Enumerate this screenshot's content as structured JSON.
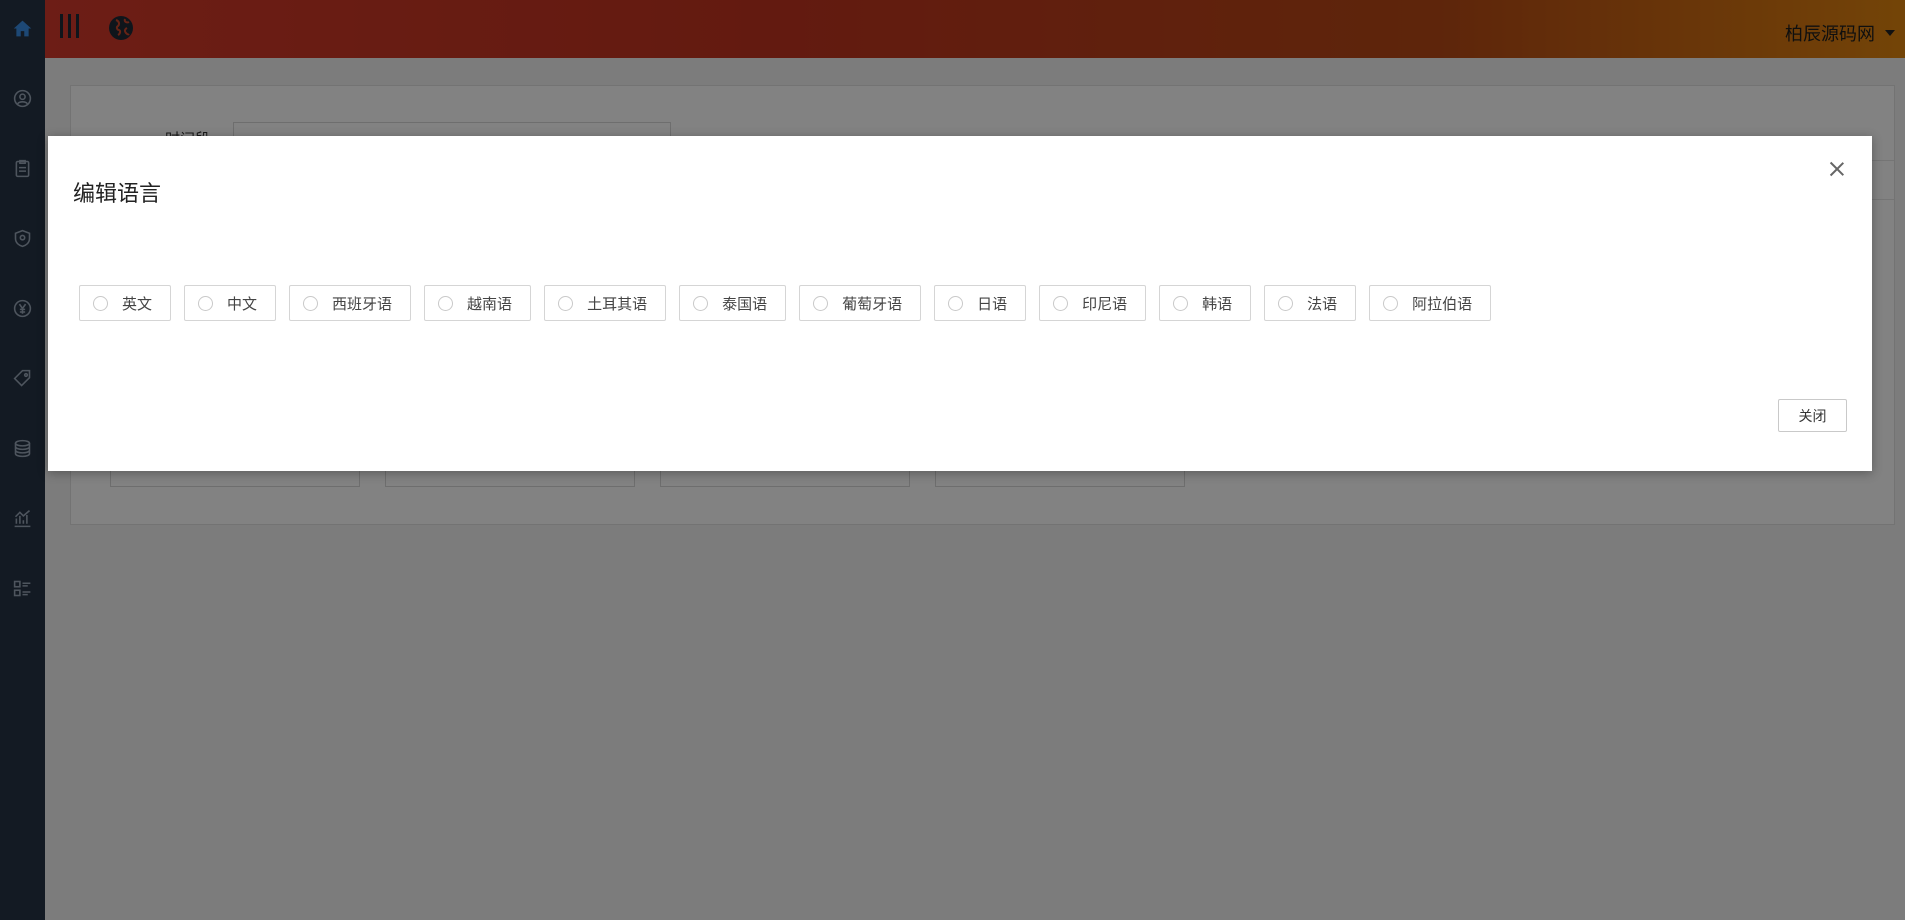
{
  "header": {
    "username": "柏辰源码网"
  },
  "background": {
    "field_label": "时间段"
  },
  "modal": {
    "title": "编辑语言",
    "languages": [
      "英文",
      "中文",
      "西班牙语",
      "越南语",
      "土耳其语",
      "泰国语",
      "葡萄牙语",
      "日语",
      "印尼语",
      "韩语",
      "法语",
      "阿拉伯语"
    ],
    "close_label": "关闭"
  },
  "colors": {
    "sidebar": "#263445",
    "header_gradient_start": "#d63a2b",
    "header_gradient_end": "#e2860f"
  },
  "icons": {
    "sidebar": [
      "home-icon",
      "user-circle-icon",
      "clipboard-icon",
      "shield-icon",
      "yen-icon",
      "tag-icon",
      "coins-icon",
      "chart-icon",
      "list-icon"
    ],
    "header": [
      "menu-toggle-icon",
      "globe-icon",
      "caret-down-icon"
    ]
  }
}
